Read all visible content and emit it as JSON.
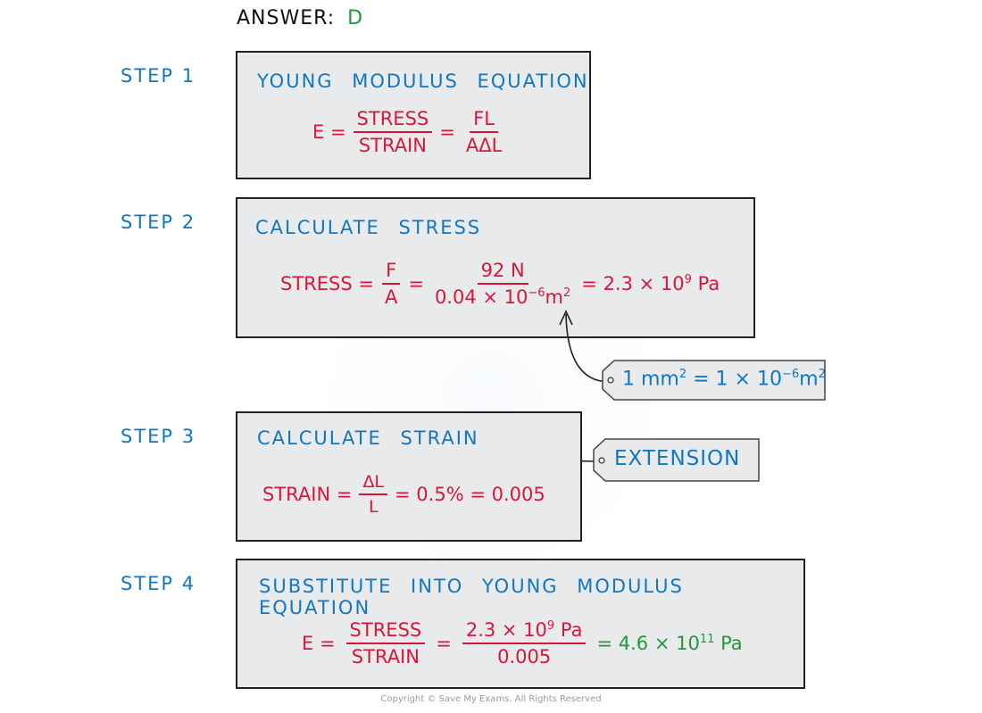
{
  "answer": {
    "label": "ANSWER:",
    "value": "D"
  },
  "steps": [
    {
      "label": "STEP 1",
      "title": "YOUNG MODULUS EQUATION",
      "equation": {
        "lhs": "E =",
        "frac1_num": "STRESS",
        "frac1_den": "STRAIN",
        "eq2": "=",
        "frac2_num": "FL",
        "frac2_den": "AΔL"
      }
    },
    {
      "label": "STEP 2",
      "title": "CALCULATE STRESS",
      "equation": {
        "lhs": "STRESS =",
        "frac1_num": "F",
        "frac1_den": "A",
        "eq2": "=",
        "frac2_num": "92 N",
        "frac2_den_base": "0.04 × 10",
        "frac2_den_exp": "−6",
        "frac2_den_unit": "m",
        "frac2_den_unit_exp": "2",
        "result_base": "= 2.3 × 10",
        "result_exp": "9",
        "result_unit": "Pa"
      }
    },
    {
      "label": "STEP 3",
      "title": "CALCULATE STRAIN",
      "equation": {
        "lhs": "STRAIN =",
        "frac_num": "ΔL",
        "frac_den": "L",
        "rest": "= 0.5% = 0.005"
      }
    },
    {
      "label": "STEP 4",
      "title": "SUBSTITUTE INTO YOUNG MODULUS EQUATION",
      "equation": {
        "lhs": "E =",
        "frac1_num": "STRESS",
        "frac1_den": "STRAIN",
        "eq2": "=",
        "frac2_num_base": "2.3 × 10",
        "frac2_num_exp": "9",
        "frac2_num_unit": "Pa",
        "frac2_den": "0.005",
        "result_base": "= 4.6 × 10",
        "result_exp": "11",
        "result_unit": "Pa"
      }
    }
  ],
  "annotations": {
    "unit_conversion": {
      "left": "1 mm",
      "left_exp": "2",
      "mid": " = 1 × 10",
      "mid_exp": "−6",
      "unit": "m",
      "unit_exp": "2"
    },
    "extension": {
      "text": "EXTENSION"
    }
  },
  "copyright": "Copyright © Save My Exams. All Rights Reserved",
  "colors": {
    "heading_blue": "#1177c2",
    "equation_red": "#d8163a",
    "answer_green": "#1f9a3a",
    "box_fill": "#e9eaeb"
  }
}
